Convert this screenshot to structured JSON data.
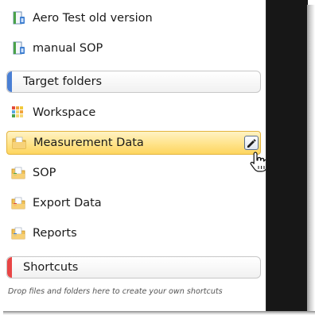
{
  "documents": [
    {
      "label": "Aero Test old version",
      "icon": "document-icon"
    },
    {
      "label": "manual SOP",
      "icon": "document-icon"
    }
  ],
  "target_folders": {
    "header_label": "Target folders",
    "accent_color": "#4a7fd4",
    "items": [
      {
        "label": "Workspace",
        "icon": "workspace-icon"
      },
      {
        "label": "Measurement Data",
        "icon": "folder-icon",
        "selected": true
      },
      {
        "label": "SOP",
        "icon": "folder-green-icon"
      },
      {
        "label": "Export Data",
        "icon": "folder-red-icon"
      },
      {
        "label": "Reports",
        "icon": "folder-blue-icon"
      }
    ]
  },
  "shortcuts": {
    "header_label": "Shortcuts",
    "accent_color": "#e84545",
    "hint": "Drop files and folders here to create your own shortcuts"
  },
  "colors": {
    "selection_fill": "#ffe38a",
    "selection_border": "#e3b43d",
    "dark_panel": "#171717"
  }
}
